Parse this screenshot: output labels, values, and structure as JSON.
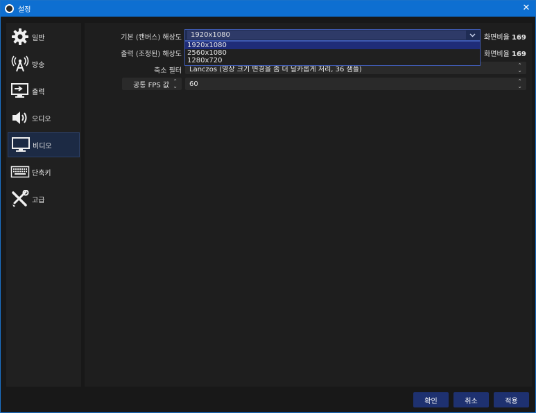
{
  "window": {
    "title": "설정",
    "close_glyph": "✕"
  },
  "sidebar": {
    "items": [
      {
        "id": "general",
        "label": "일반",
        "icon": "gear-icon"
      },
      {
        "id": "stream",
        "label": "방송",
        "icon": "antenna-icon"
      },
      {
        "id": "output",
        "label": "출력",
        "icon": "output-monitor-icon"
      },
      {
        "id": "audio",
        "label": "오디오",
        "icon": "speaker-icon"
      },
      {
        "id": "video",
        "label": "비디오",
        "icon": "monitor-icon",
        "active": true
      },
      {
        "id": "hotkeys",
        "label": "단축키",
        "icon": "keyboard-icon"
      },
      {
        "id": "advanced",
        "label": "고급",
        "icon": "tools-icon"
      }
    ]
  },
  "video": {
    "base_resolution": {
      "label": "기본 (캔버스) 해상도",
      "value": "1920x1080",
      "options": [
        "1920x1080",
        "2560x1080",
        "1280x720"
      ],
      "ratio_label": "화면비율",
      "ratio_value": "169"
    },
    "output_resolution": {
      "label": "출력 (조정된) 해상도",
      "ratio_label": "화면비율",
      "ratio_value": "169"
    },
    "downscale_filter": {
      "label": "축소 필터",
      "value": "Lanczos (영상 크기 변경을 좀 더 날카롭게 처리, 36 샘플)"
    },
    "fps": {
      "type_label": "공통 FPS 값",
      "value": "60"
    }
  },
  "buttons": {
    "ok": "확인",
    "cancel": "취소",
    "apply": "적용"
  },
  "colors": {
    "title_bar": "#0e6fd1",
    "button": "#1e3170",
    "active_item": "#1c2a44",
    "dropdown_selected": "#1f2c78"
  }
}
